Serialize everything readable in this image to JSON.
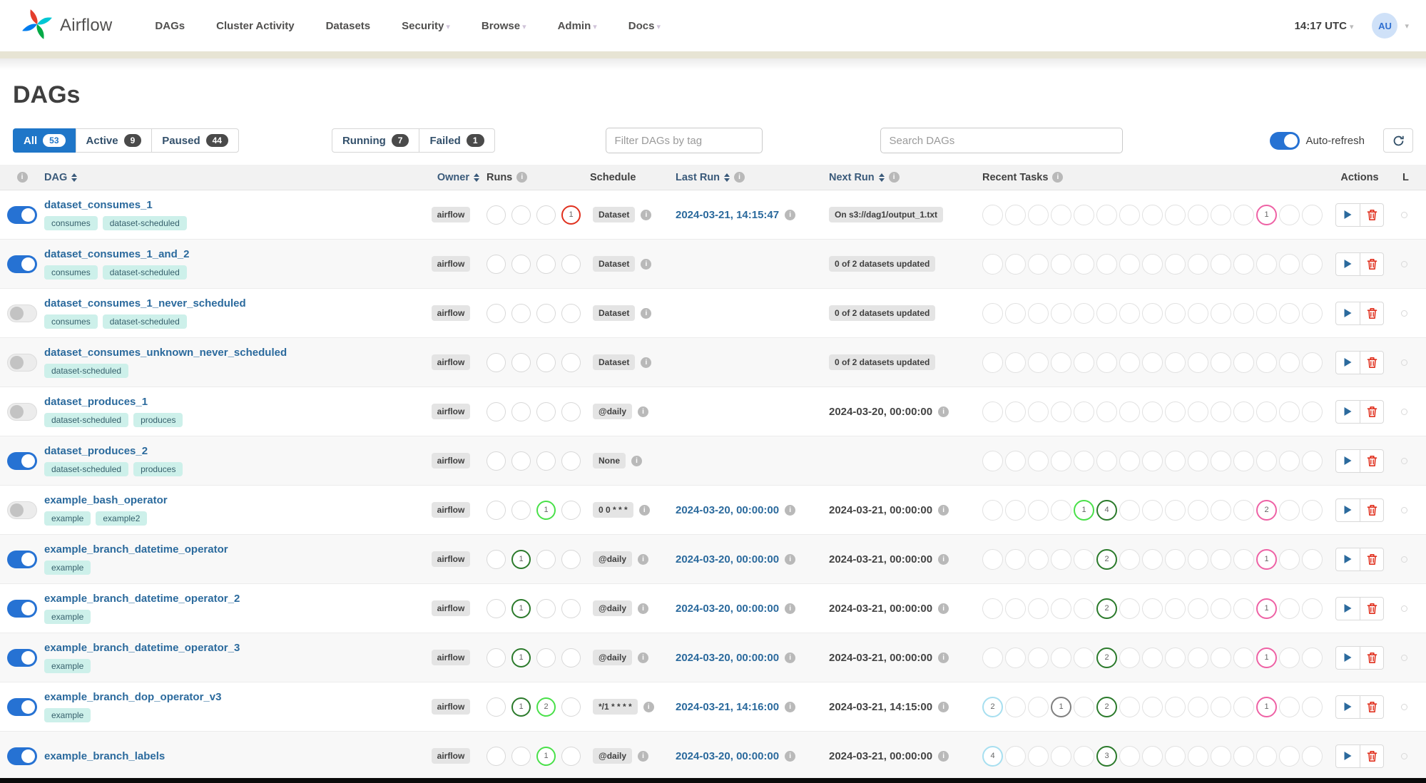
{
  "navbar": {
    "brand": "Airflow",
    "items": [
      {
        "label": "DAGs",
        "caret": false
      },
      {
        "label": "Cluster Activity",
        "caret": false
      },
      {
        "label": "Datasets",
        "caret": false
      },
      {
        "label": "Security",
        "caret": true
      },
      {
        "label": "Browse",
        "caret": true
      },
      {
        "label": "Admin",
        "caret": true
      },
      {
        "label": "Docs",
        "caret": true
      }
    ],
    "clock": "14:17 UTC",
    "avatar": "AU"
  },
  "page": {
    "title": "DAGs"
  },
  "controls": {
    "state_filters": [
      {
        "label": "All",
        "count": "53",
        "active": true
      },
      {
        "label": "Active",
        "count": "9",
        "active": false
      },
      {
        "label": "Paused",
        "count": "44",
        "active": false
      }
    ],
    "run_filters": [
      {
        "label": "Running",
        "count": "7",
        "active": false
      },
      {
        "label": "Failed",
        "count": "1",
        "active": false
      }
    ],
    "tag_placeholder": "Filter DAGs by tag",
    "search_placeholder": "Search DAGs",
    "auto_refresh_label": "Auto-refresh"
  },
  "table": {
    "headers": [
      {
        "key": "toggle",
        "label": "",
        "sort": false,
        "info": true
      },
      {
        "key": "dag",
        "label": "DAG",
        "sort": true,
        "info": false
      },
      {
        "key": "owner",
        "label": "Owner",
        "sort": true,
        "info": false
      },
      {
        "key": "runs",
        "label": "Runs",
        "sort": false,
        "info": true
      },
      {
        "key": "schedule",
        "label": "Schedule",
        "sort": false,
        "info": false
      },
      {
        "key": "last",
        "label": "Last Run",
        "sort": true,
        "info": true
      },
      {
        "key": "next",
        "label": "Next Run",
        "sort": true,
        "info": true
      },
      {
        "key": "tasks",
        "label": "Recent Tasks",
        "sort": false,
        "info": true
      },
      {
        "key": "actions",
        "label": "Actions",
        "sort": false,
        "info": false
      },
      {
        "key": "links",
        "label": "L",
        "sort": false,
        "info": false
      }
    ],
    "run_slots": 4,
    "task_slots": 15,
    "rows": [
      {
        "name": "dataset_consumes_1",
        "enabled": true,
        "tags": [
          "consumes",
          "dataset-scheduled"
        ],
        "owner": "airflow",
        "runs": [
          {
            "i": 3,
            "state": "failed",
            "n": "1"
          }
        ],
        "schedule": "Dataset",
        "last_run": "2024-03-21, 14:15:47",
        "next_run": {
          "type": "badge",
          "value": "On s3://dag1/output_1.txt"
        },
        "tasks": [
          {
            "i": 12,
            "state": "skipped",
            "n": "1"
          }
        ]
      },
      {
        "name": "dataset_consumes_1_and_2",
        "enabled": true,
        "tags": [
          "consumes",
          "dataset-scheduled"
        ],
        "owner": "airflow",
        "runs": [],
        "schedule": "Dataset",
        "last_run": "",
        "next_run": {
          "type": "badge",
          "value": "0 of 2 datasets updated"
        },
        "tasks": []
      },
      {
        "name": "dataset_consumes_1_never_scheduled",
        "enabled": false,
        "tags": [
          "consumes",
          "dataset-scheduled"
        ],
        "owner": "airflow",
        "runs": [],
        "schedule": "Dataset",
        "last_run": "",
        "next_run": {
          "type": "badge",
          "value": "0 of 2 datasets updated"
        },
        "tasks": []
      },
      {
        "name": "dataset_consumes_unknown_never_scheduled",
        "enabled": false,
        "tags": [
          "dataset-scheduled"
        ],
        "owner": "airflow",
        "runs": [],
        "schedule": "Dataset",
        "last_run": "",
        "next_run": {
          "type": "badge",
          "value": "0 of 2 datasets updated"
        },
        "tasks": []
      },
      {
        "name": "dataset_produces_1",
        "enabled": false,
        "tags": [
          "dataset-scheduled",
          "produces"
        ],
        "owner": "airflow",
        "runs": [],
        "schedule": "@daily",
        "last_run": "",
        "next_run": {
          "type": "date",
          "value": "2024-03-20, 00:00:00"
        },
        "tasks": []
      },
      {
        "name": "dataset_produces_2",
        "enabled": true,
        "tags": [
          "dataset-scheduled",
          "produces"
        ],
        "owner": "airflow",
        "runs": [],
        "schedule": "None",
        "last_run": "",
        "next_run": {
          "type": "none",
          "value": ""
        },
        "tasks": []
      },
      {
        "name": "example_bash_operator",
        "enabled": false,
        "tags": [
          "example",
          "example2"
        ],
        "owner": "airflow",
        "runs": [
          {
            "i": 2,
            "state": "running",
            "n": "1"
          }
        ],
        "schedule": "0 0 * * *",
        "last_run": "2024-03-20, 00:00:00",
        "next_run": {
          "type": "date",
          "value": "2024-03-21, 00:00:00"
        },
        "tasks": [
          {
            "i": 4,
            "state": "running",
            "n": "1"
          },
          {
            "i": 5,
            "state": "success",
            "n": "4"
          },
          {
            "i": 12,
            "state": "skipped",
            "n": "2"
          }
        ]
      },
      {
        "name": "example_branch_datetime_operator",
        "enabled": true,
        "tags": [
          "example"
        ],
        "owner": "airflow",
        "runs": [
          {
            "i": 1,
            "state": "success",
            "n": "1"
          }
        ],
        "schedule": "@daily",
        "last_run": "2024-03-20, 00:00:00",
        "next_run": {
          "type": "date",
          "value": "2024-03-21, 00:00:00"
        },
        "tasks": [
          {
            "i": 5,
            "state": "success",
            "n": "2"
          },
          {
            "i": 12,
            "state": "skipped",
            "n": "1"
          }
        ]
      },
      {
        "name": "example_branch_datetime_operator_2",
        "enabled": true,
        "tags": [
          "example"
        ],
        "owner": "airflow",
        "runs": [
          {
            "i": 1,
            "state": "success",
            "n": "1"
          }
        ],
        "schedule": "@daily",
        "last_run": "2024-03-20, 00:00:00",
        "next_run": {
          "type": "date",
          "value": "2024-03-21, 00:00:00"
        },
        "tasks": [
          {
            "i": 5,
            "state": "success",
            "n": "2"
          },
          {
            "i": 12,
            "state": "skipped",
            "n": "1"
          }
        ]
      },
      {
        "name": "example_branch_datetime_operator_3",
        "enabled": true,
        "tags": [
          "example"
        ],
        "owner": "airflow",
        "runs": [
          {
            "i": 1,
            "state": "success",
            "n": "1"
          }
        ],
        "schedule": "@daily",
        "last_run": "2024-03-20, 00:00:00",
        "next_run": {
          "type": "date",
          "value": "2024-03-21, 00:00:00"
        },
        "tasks": [
          {
            "i": 5,
            "state": "success",
            "n": "2"
          },
          {
            "i": 12,
            "state": "skipped",
            "n": "1"
          }
        ]
      },
      {
        "name": "example_branch_dop_operator_v3",
        "enabled": true,
        "tags": [
          "example"
        ],
        "owner": "airflow",
        "runs": [
          {
            "i": 1,
            "state": "success",
            "n": "1"
          },
          {
            "i": 2,
            "state": "running",
            "n": "2"
          }
        ],
        "schedule": "*/1 * * * *",
        "last_run": "2024-03-21, 14:16:00",
        "next_run": {
          "type": "date",
          "value": "2024-03-21, 14:15:00"
        },
        "tasks": [
          {
            "i": 0,
            "state": "none",
            "n": "2"
          },
          {
            "i": 3,
            "state": "queued",
            "n": "1"
          },
          {
            "i": 5,
            "state": "success",
            "n": "2"
          },
          {
            "i": 12,
            "state": "skipped",
            "n": "1"
          }
        ]
      },
      {
        "name": "example_branch_labels",
        "enabled": true,
        "tags": [],
        "owner": "airflow",
        "runs": [
          {
            "i": 2,
            "state": "running",
            "n": "1"
          }
        ],
        "schedule": "@daily",
        "last_run": "2024-03-20, 00:00:00",
        "next_run": {
          "type": "date",
          "value": "2024-03-21, 00:00:00"
        },
        "tasks": [
          {
            "i": 0,
            "state": "none",
            "n": "4"
          },
          {
            "i": 5,
            "state": "success",
            "n": "3"
          }
        ]
      }
    ]
  },
  "colors": {
    "accent_blue": "#1f76c8",
    "failed": "#e0301e",
    "running": "#49e049",
    "success": "#2b7a2b",
    "skipped": "#ee62a5",
    "none": "#a7dff0",
    "queued": "#7f7f7f"
  }
}
